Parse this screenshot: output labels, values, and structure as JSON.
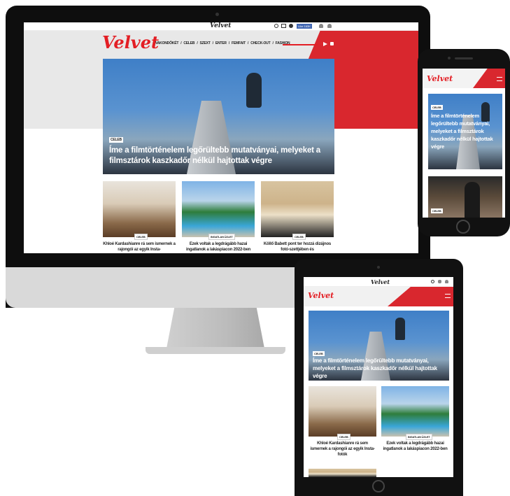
{
  "brand": {
    "logo": "Velvet",
    "accent": "#e31e24"
  },
  "desktop": {
    "topbar_logo": "Velvet",
    "like_button": "Like 163K",
    "nav": [
      "VAKONDŐKÉT",
      "CELEB",
      "SZEXT",
      "ENTER",
      "FEMFAIT",
      "CHECK-OUT",
      "FASHION"
    ],
    "hero": {
      "tag": "CELEB",
      "title": "Íme a filmtörténelem legőrültebb mutatványai, melyeket a filmsztárok kaszkadőr nélkül hajtottak végre"
    },
    "tiles": [
      {
        "tag": "CELEB",
        "text": "Khloé Kardashianre rá sem ismernek a rajongói az egyik Insta-"
      },
      {
        "tag": "INGATLAN ÜZLET",
        "text": "Ezek voltak a legdrágább hazai ingatlanok a lakáspiacon 2022-ben"
      },
      {
        "tag": "CELEB",
        "text": "Köllő Babett pont ter hozzá dizájnos fotó-szettjében és"
      }
    ]
  },
  "phone": {
    "logo": "Velvet",
    "hero": {
      "tag": "CELEB",
      "title": "Íme a filmtörténelem legőrültebb mutatványai, melyeket a filmsztárok kaszkadőr nélkül hajtottak végre"
    },
    "second_tag": "CELEB"
  },
  "tablet": {
    "topbar_logo": "Velvet",
    "logo": "Velvet",
    "hero": {
      "tag": "CELEB",
      "title": "Íme a filmtörténelem legőrültebb mutatványai, melyeket a filmsztárok kaszkadőr nélkül hajtottak végre"
    },
    "tiles": [
      {
        "tag": "CELEB",
        "text": "Khloé Kardashianre rá sem ismernek a rajongói az egyik Insta-fotók"
      },
      {
        "tag": "INGATLAN ÜZLET",
        "text": "Ezek voltak a legdrágább hazai ingatlanok a lakáspiacon 2022-ben"
      }
    ]
  }
}
